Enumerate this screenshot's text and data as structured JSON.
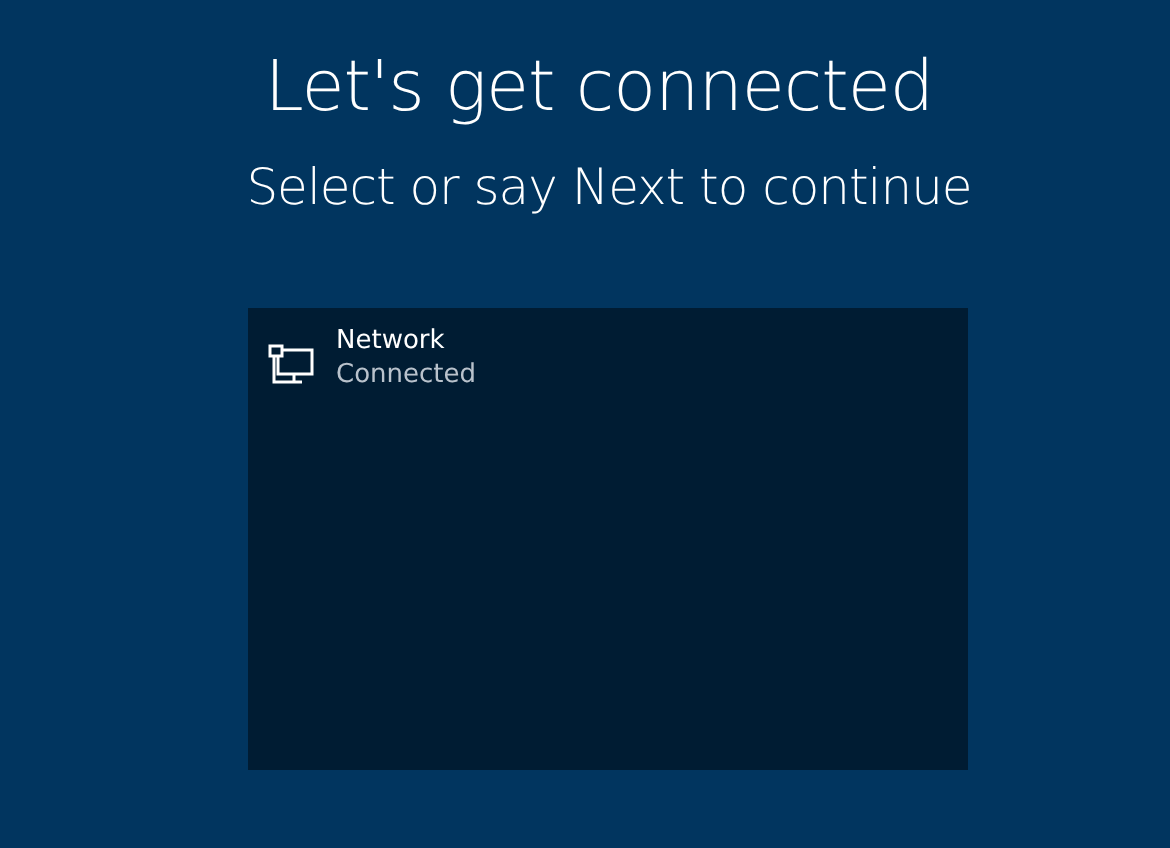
{
  "title": "Let's get connected",
  "subtitle": "Select or say Next to continue",
  "networks": [
    {
      "name": "Network",
      "status": "Connected"
    }
  ]
}
